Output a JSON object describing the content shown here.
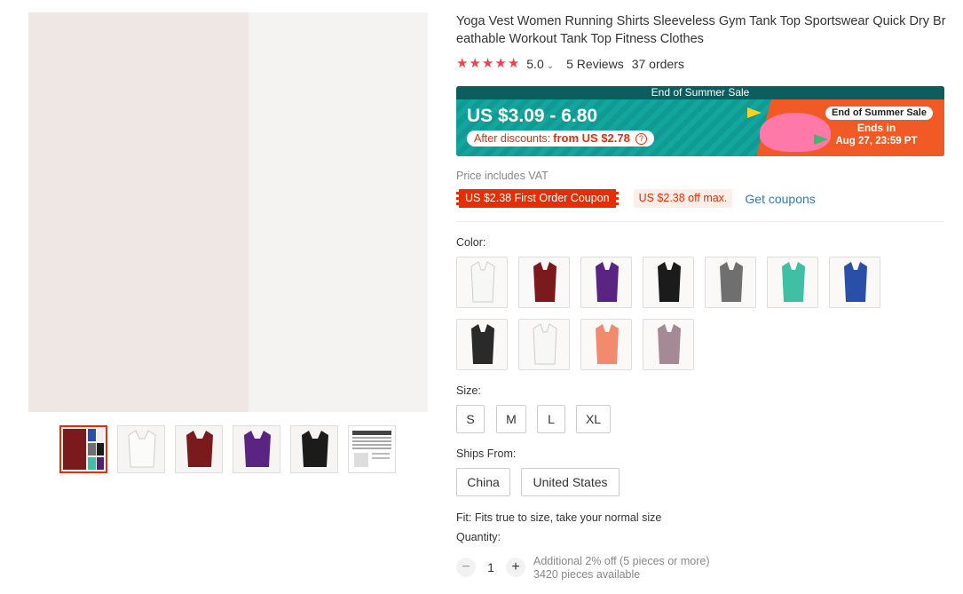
{
  "product": {
    "title": "Yoga Vest Women Running Shirts Sleeveless Gym Tank Top Sportswear Quick Dry Breathable Workout Tank Top Fitness Clothes",
    "rating": {
      "stars": 5,
      "score": "5.0",
      "reviews": "5 Reviews",
      "orders": "37 orders"
    }
  },
  "gallery": {
    "main_colors": {
      "wine": "#7b1a1c",
      "blue": "#2a4fa8",
      "white": "#f3f3f1",
      "gray": "#6f6f6f",
      "black": "#1b1b1b",
      "teal": "#3fbfa3",
      "purple": "#4e2170"
    },
    "thumbnails": [
      {
        "color": "#7b1a1c",
        "icon": "collage-thumb"
      },
      {
        "color": "#f3f3f1",
        "icon": "tank-thumb"
      },
      {
        "color": "#7b1a1c",
        "icon": "tank-thumb"
      },
      {
        "color": "#4e2170",
        "icon": "tank-thumb"
      },
      {
        "color": "#1b1b1b",
        "icon": "tank-thumb"
      },
      {
        "color": "#ffffff",
        "icon": "size-chart-thumb"
      }
    ]
  },
  "sale_banner": {
    "header": "End of Summer Sale",
    "price_range": "US $3.09 - 6.80",
    "after_discount_label": "After discounts:",
    "after_discount_value": "from US $2.78",
    "badge": "End of Summer Sale",
    "ends_label": "Ends in",
    "ends_date": "Aug 27, 23:59 PT",
    "colors": {
      "teal": "#12a19a",
      "orange": "#f15a24",
      "pink": "#ff79a8"
    }
  },
  "pricing": {
    "vat_note": "Price includes VAT",
    "coupon_first_order": "US $2.38 First Order Coupon",
    "coupon_max": "US $2.38 off max.",
    "get_coupons": "Get coupons"
  },
  "color": {
    "label": "Color:",
    "swatches": [
      {
        "fill": "#f3f3f1"
      },
      {
        "fill": "#7b1a1c"
      },
      {
        "fill": "#5a2582"
      },
      {
        "fill": "#1b1b1b"
      },
      {
        "fill": "#6f6f6f"
      },
      {
        "fill": "#3fbfa3"
      },
      {
        "fill": "#2a4fa8"
      },
      {
        "fill": "#2a2a2a"
      },
      {
        "fill": "#f3f3f1"
      },
      {
        "fill": "#f28a6d"
      },
      {
        "fill": "#a58a96"
      }
    ]
  },
  "size": {
    "label": "Size:",
    "options": [
      "S",
      "M",
      "L",
      "XL"
    ]
  },
  "ships_from": {
    "label": "Ships From:",
    "options": [
      "China",
      "United States"
    ]
  },
  "fit_note": "Fit: Fits true to size, take your normal size",
  "quantity": {
    "label": "Quantity:",
    "value": "1",
    "minus": "−",
    "plus": "+",
    "discount_note": "Additional 2% off (5 pieces or more)",
    "available": "3420 pieces available"
  }
}
